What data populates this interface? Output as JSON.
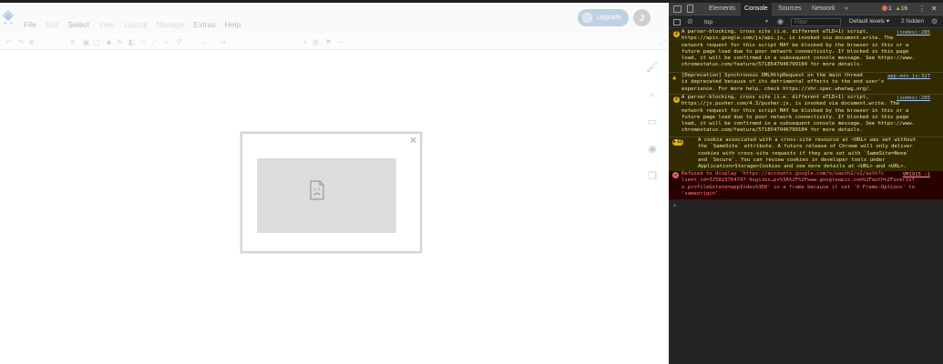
{
  "app": {
    "menu": [
      "File",
      "Edit",
      "Select",
      "View",
      "Layout",
      "Manage",
      "Extras",
      "Help"
    ],
    "upgrade_label": "Upgrade",
    "avatar_initial": "J"
  },
  "devtools": {
    "tabs": [
      "Elements",
      "Console",
      "Sources",
      "Network"
    ],
    "more_tabs": "»",
    "error_count": "1",
    "warning_count": "16",
    "context": "top",
    "filter_placeholder": "Filter",
    "levels_label": "Default levels ▾",
    "hidden_label": "2 hidden",
    "messages": [
      {
        "type": "warn",
        "count": "2",
        "source": "(index):285",
        "lines": [
          "A parser-blocking, cross site (i.e. different eTLD+1) script,",
          "https://apis.google.com/js/api.js, is invoked via document.write. The",
          "network request for this script MAY be blocked by the browser in this or a",
          "future page load due to poor network connectivity. If blocked in this page",
          "load, it will be confirmed in a subsequent console message. See https://www.",
          "chromestatus.com/feature/5718547946799104 for more details."
        ]
      },
      {
        "type": "warn",
        "count": "",
        "source": "app.min.js:327",
        "lines": [
          "[Deprecation] Synchronous XMLHttpRequest on the main thread",
          "is deprecated because of its detrimental effects to the end user's",
          "experience. For more help, check https://xhr.spec.whatwg.org/."
        ]
      },
      {
        "type": "warn",
        "count": "2",
        "source": "(index):285",
        "lines": [
          "A parser-blocking, cross site (i.e. different eTLD+1) script,",
          "https://js.pusher.com/4.3/pusher.js, is invoked via document.write. The",
          "network request for this script MAY be blocked by the browser in this or a",
          "future page load due to poor network connectivity. If blocked in this page",
          "load, it will be confirmed in a subsequent console message. See https://www.",
          "chromestatus.com/feature/5718547946799104 for more details."
        ]
      },
      {
        "type": "warn",
        "count": "11",
        "source": "",
        "lines": [
          "A cookie associated with a cross-site resource at <URL> was set without",
          "the `SameSite` attribute. A future release of Chrome will only deliver",
          "cookies with cross-site requests if they are set with `SameSite=None`",
          "and `Secure`. You can review cookies in developer tools under",
          "Application>Storage>Cookies and see more details at <URL> and <URL>."
        ]
      },
      {
        "type": "error",
        "count": "",
        "source": "VM1915 :1",
        "lines": [
          "Refused to display 'https://accounts.google.com/o/oauth2/v2/auth?c",
          "lient_id=325823764747-9ugiiks…ps%3A%2F%2Fwww.googleapis.com%2Fauth%2Fuserinf",
          "o.profile&state=appIndex%3D0' in a frame because it set 'X-Frame-Options' to",
          "'sameorigin'."
        ]
      }
    ],
    "prompt": "›"
  }
}
